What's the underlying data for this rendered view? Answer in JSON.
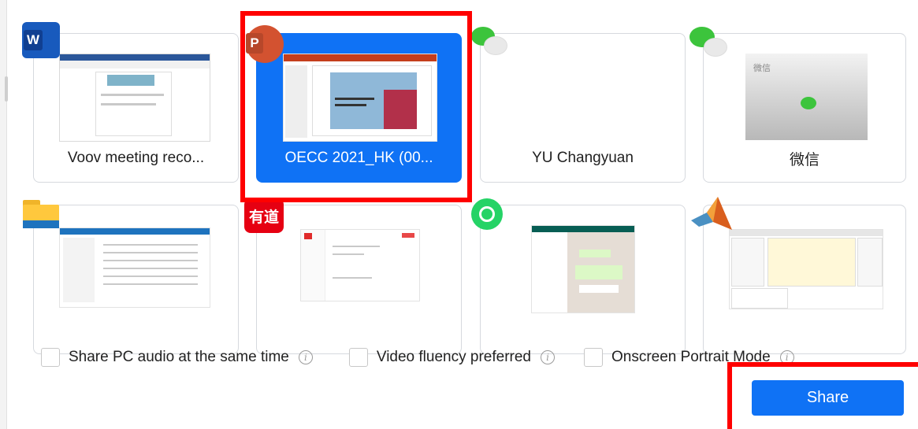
{
  "windows": [
    {
      "label": "Voov meeting reco...",
      "app": "word-icon",
      "selected": false
    },
    {
      "label": "OECC 2021_HK (00...",
      "app": "powerpoint-icon",
      "selected": true
    },
    {
      "label": "YU Changyuan",
      "app": "wechat-icon",
      "selected": false
    },
    {
      "label": "微信",
      "app": "wechat-icon",
      "selected": false
    },
    {
      "label": "",
      "app": "file-explorer-icon",
      "selected": false
    },
    {
      "label": "",
      "app": "youdao-icon",
      "selected": false
    },
    {
      "label": "",
      "app": "whatsapp-icon",
      "selected": false
    },
    {
      "label": "",
      "app": "matlab-icon",
      "selected": false
    }
  ],
  "icons": {
    "word_letter": "W",
    "ppt_letter": "P",
    "youdao_text": "有道",
    "wechat_thumb_text": "微信"
  },
  "options": {
    "share_audio": "Share PC audio at the same time",
    "video_fluency": "Video fluency preferred",
    "portrait_mode": "Onscreen Portrait Mode",
    "info_glyph": "i"
  },
  "actions": {
    "share_label": "Share"
  },
  "colors": {
    "accent": "#0f72f5",
    "highlight": "#ff0000"
  }
}
